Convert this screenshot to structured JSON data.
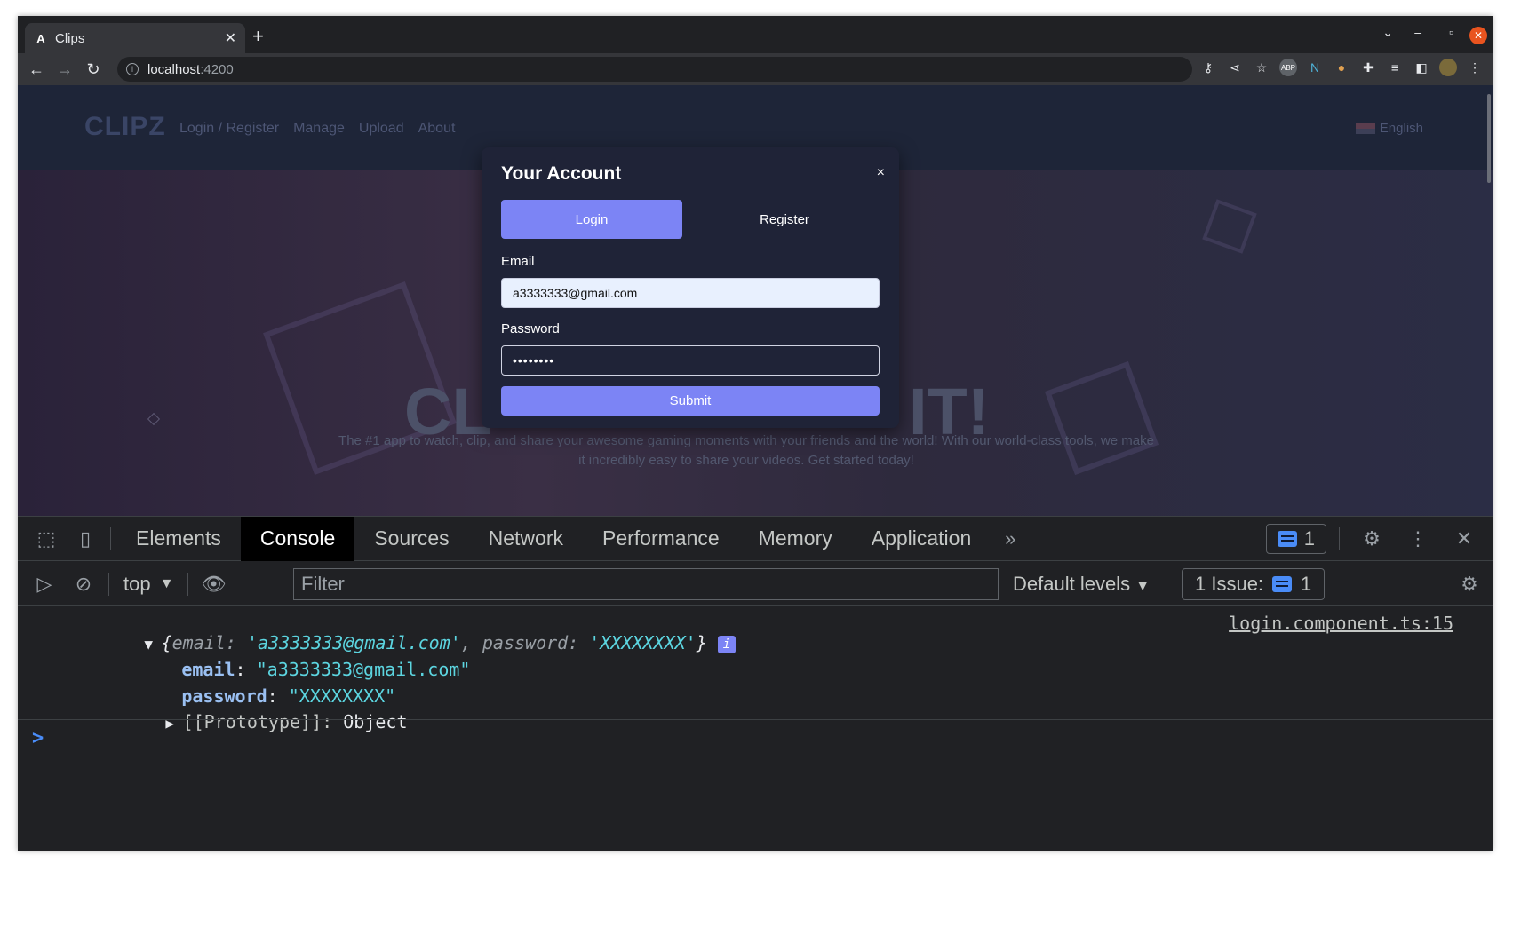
{
  "browser": {
    "tab_title": "Clips",
    "tab_favicon": "A",
    "url_host": "localhost",
    "url_port": ":4200"
  },
  "site": {
    "logo": "CLIPZ",
    "nav": [
      "Login / Register",
      "Manage",
      "Upload",
      "About"
    ],
    "language": "English",
    "hero_left": "CL",
    "hero_right": "IT!",
    "hero_sub": "The #1 app to watch, clip, and share your awesome gaming moments with your friends and the world! With our world-class tools, we make it incredibly easy to share your videos. Get started today!"
  },
  "modal": {
    "title": "Your Account",
    "close": "×",
    "tab_login": "Login",
    "tab_register": "Register",
    "email_label": "Email",
    "email_value": "a3333333@gmail.com",
    "password_label": "Password",
    "password_value": "••••••••",
    "submit": "Submit"
  },
  "devtools": {
    "tabs": [
      "Elements",
      "Console",
      "Sources",
      "Network",
      "Performance",
      "Memory",
      "Application"
    ],
    "active_tab": "Console",
    "message_count": "1",
    "context": "top",
    "filter_placeholder": "Filter",
    "levels": "Default levels",
    "issues_label": "1 Issue:",
    "issues_count": "1"
  },
  "console": {
    "log_key_email": "email",
    "log_val_email": "'a3333333@gmail.com'",
    "log_key_password": "password",
    "log_val_password": "'XXXXXXXX'",
    "source": "login.component.ts:15",
    "prop_email": "email",
    "prop_email_value": "\"a3333333@gmail.com\"",
    "prop_password": "password",
    "prop_password_value": "\"XXXXXXXX\"",
    "prototype": "[[Prototype]]",
    "prototype_value": "Object"
  },
  "colors": {
    "accent": "#7c84f5",
    "modal_bg": "#1f2337",
    "devtools_bg": "#202124"
  }
}
